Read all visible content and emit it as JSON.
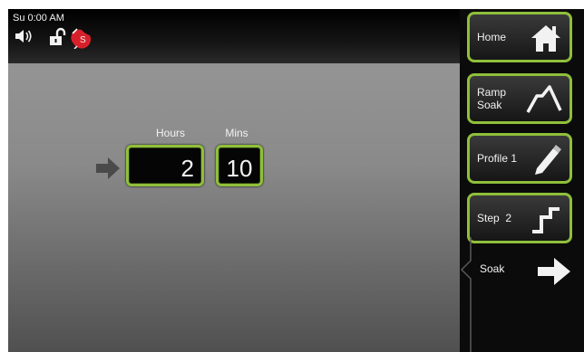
{
  "status": {
    "clock": "Su 0:00 AM",
    "icons": [
      "speaker-icon",
      "unlock-icon",
      "alarm-icon"
    ]
  },
  "timer": {
    "hours_label": "Hours",
    "mins_label": "Mins",
    "hours_value": "2",
    "mins_value": "10"
  },
  "sidebar": {
    "home": {
      "label": "Home",
      "icon": "home-icon"
    },
    "ramp_soak": {
      "label_line1": "Ramp",
      "label_line2": "Soak",
      "icon": "ramp-soak-icon"
    },
    "profile": {
      "label": "Profile 1",
      "icon": "pencil-icon"
    },
    "step": {
      "label": "Step  2",
      "icon": "step-icon"
    },
    "soak": {
      "label": "Soak",
      "icon": "arrow-right-icon"
    }
  },
  "colors": {
    "accent": "#8fbf3a",
    "panel": "#0b0b0b"
  }
}
